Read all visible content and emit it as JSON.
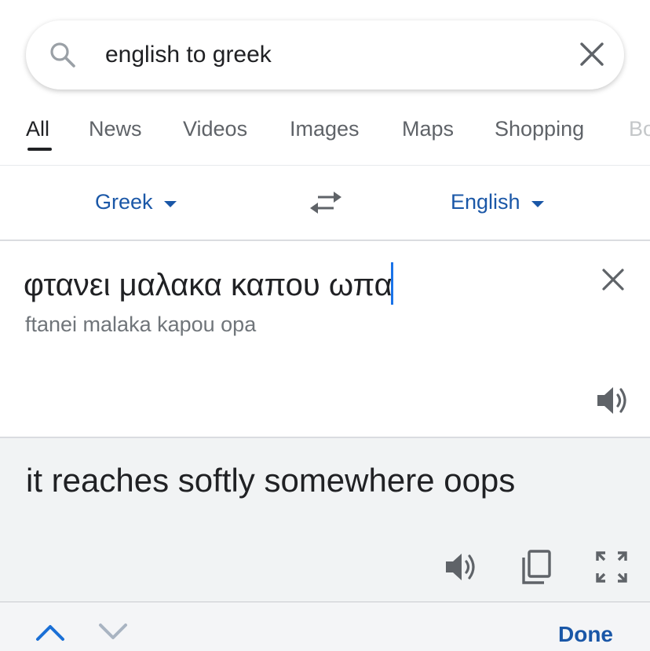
{
  "search": {
    "query": "english to greek"
  },
  "tabs": [
    {
      "label": "All",
      "active": true
    },
    {
      "label": "News",
      "active": false
    },
    {
      "label": "Videos",
      "active": false
    },
    {
      "label": "Images",
      "active": false
    },
    {
      "label": "Maps",
      "active": false
    },
    {
      "label": "Shopping",
      "active": false
    },
    {
      "label": "Bo",
      "active": false
    }
  ],
  "translator": {
    "source_language": "Greek",
    "target_language": "English",
    "source_text": "φτανει μαλακα καπου ωπα",
    "transliteration": "ftanei malaka kapou opa",
    "translated_text": "it reaches softly somewhere oops"
  },
  "keyboard_bar": {
    "done_label": "Done"
  },
  "colors": {
    "accent": "#1a57a7",
    "cursor": "#1a73e8",
    "result_bg": "#f1f3f4"
  },
  "icons": [
    "search-icon",
    "close-icon",
    "swap-icon",
    "speaker-icon",
    "copy-icon",
    "expand-icon",
    "chevron-up-icon",
    "chevron-down-icon"
  ]
}
